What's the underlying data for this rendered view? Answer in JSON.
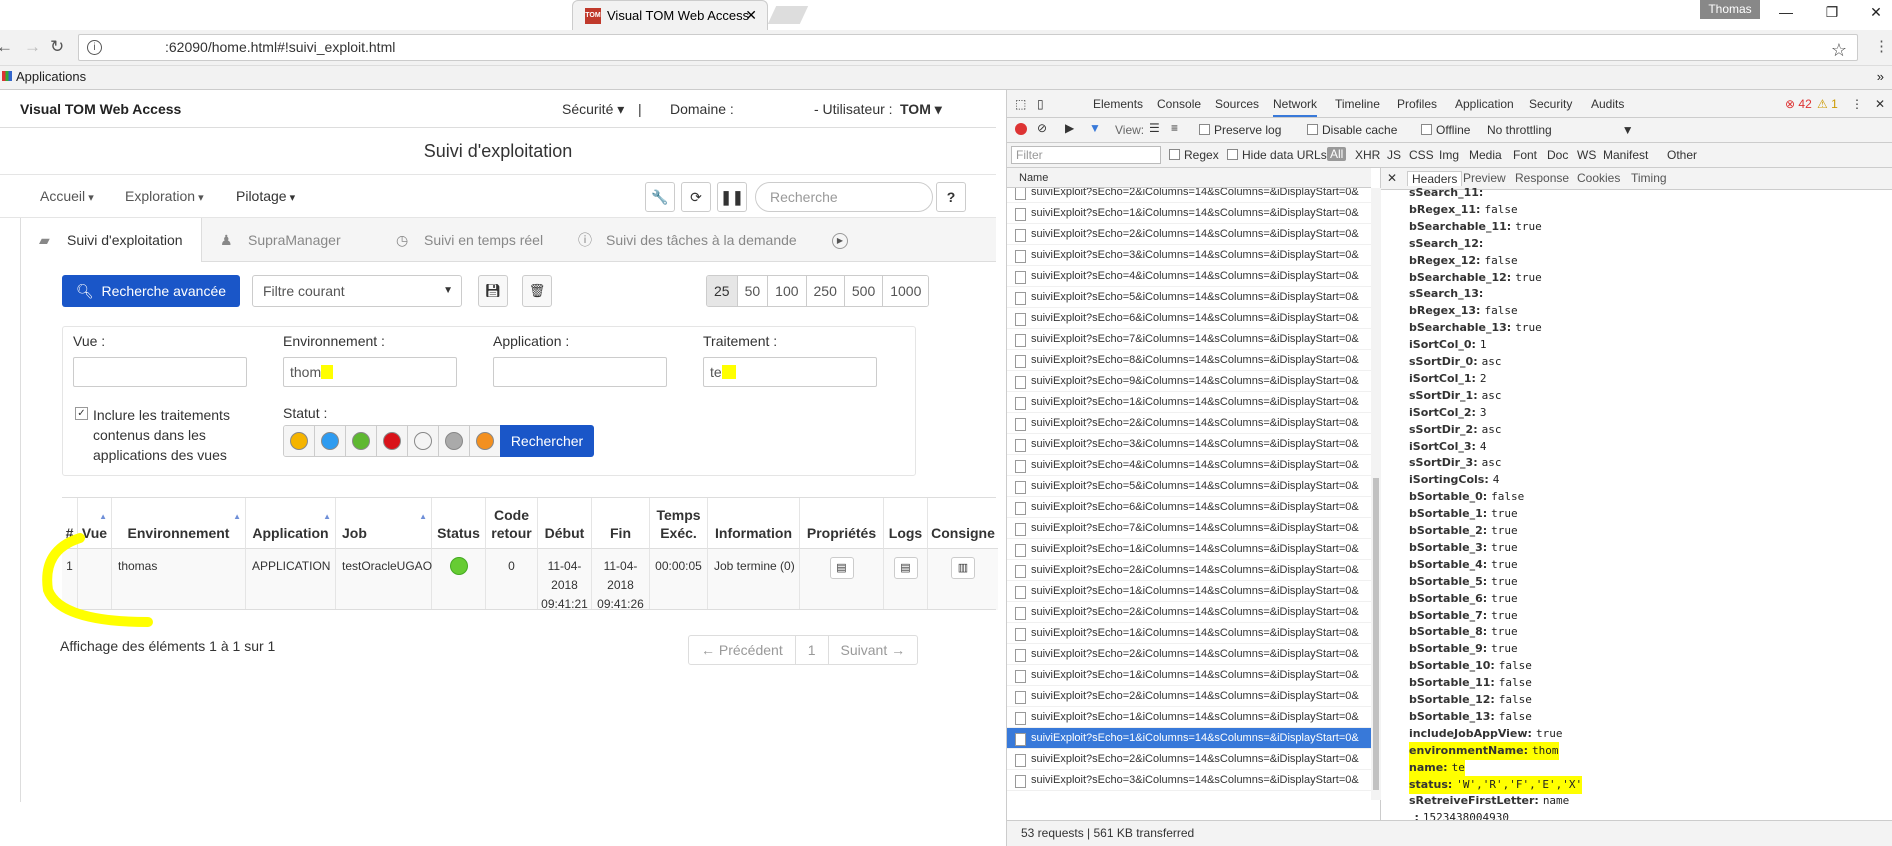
{
  "browser": {
    "tab_title": "Visual TOM Web Access",
    "tab_favicon": "TOM",
    "user": "Thomas",
    "url": ":62090/home.html#!suivi_exploit.html",
    "bookmarks_label": "Applications"
  },
  "app": {
    "brand": "Visual TOM Web Access",
    "nav": {
      "securite": "Sécurité",
      "sep": "|",
      "domaine_label": "Domaine :",
      "utilisateur_label": "- Utilisateur :",
      "utilisateur": "TOM"
    },
    "page_title": "Suivi d'exploitation",
    "menus": [
      "Accueil",
      "Exploration",
      "Pilotage"
    ],
    "search_placeholder": "Recherche",
    "help": "?",
    "tabs": [
      "Suivi d'exploitation",
      "SupraManager",
      "Suivi en temps réel",
      "Suivi des tâches à la demande"
    ],
    "adv_search": "Recherche avancée",
    "filter_select": "Filtre courant",
    "page_sizes": [
      "25",
      "50",
      "100",
      "250",
      "500",
      "1000"
    ],
    "filters": {
      "vue_label": "Vue :",
      "vue_value": "",
      "env_label": "Environnement :",
      "env_value": "thom",
      "app_label": "Application :",
      "app_value": "",
      "trait_label": "Traitement :",
      "trait_value": "te",
      "include_label": "Inclure les traitements contenus dans les applications des vues",
      "statut_label": "Statut :",
      "rechercher": "Rechercher"
    },
    "status_colors": [
      "#f5b400",
      "#2e9bf0",
      "#5fb832",
      "#d9131a",
      "#f4f4f4",
      "#aaaaaa",
      "#f39020"
    ],
    "grid": {
      "headers": [
        "#",
        "Vue",
        "Environnement",
        "Application",
        "Job",
        "Status",
        "Code retour",
        "Début",
        "Fin",
        "Temps Exéc.",
        "Information",
        "Propriétés",
        "Logs",
        "Consigne"
      ],
      "row": {
        "num": "1",
        "vue": "",
        "env": "thomas",
        "app": "APPLICATION",
        "job": "testOracleUGAO",
        "code": "0",
        "debut": "11-04-2018 09:41:21",
        "fin": "11-04-2018 09:41:26",
        "temps": "00:00:05",
        "info": "Job termine (0)"
      }
    },
    "info_text": "Affichage des éléments 1 à 1 sur 1",
    "pager": [
      "← Précédent",
      "1",
      "Suivant →"
    ]
  },
  "devtools": {
    "tabs": [
      "Elements",
      "Console",
      "Sources",
      "Network",
      "Timeline",
      "Profiles",
      "Application",
      "Security",
      "Audits"
    ],
    "errors": "42",
    "warnings": "1",
    "toolbar": {
      "view": "View:",
      "preserve": "Preserve log",
      "disable_cache": "Disable cache",
      "offline": "Offline",
      "throttle": "No throttling"
    },
    "filter_placeholder": "Filter",
    "filter_opts": [
      "Regex",
      "Hide data URLs"
    ],
    "types": [
      "All",
      "XHR",
      "JS",
      "CSS",
      "Img",
      "Media",
      "Font",
      "Doc",
      "WS",
      "Manifest",
      "Other"
    ],
    "name_header": "Name",
    "requests": [
      "suiviExploit?sEcho=2&iColumns=14&sColumns=&iDisplayStart=0&",
      "suiviExploit?sEcho=1&iColumns=14&sColumns=&iDisplayStart=0&",
      "suiviExploit?sEcho=2&iColumns=14&sColumns=&iDisplayStart=0&",
      "suiviExploit?sEcho=3&iColumns=14&sColumns=&iDisplayStart=0&",
      "suiviExploit?sEcho=4&iColumns=14&sColumns=&iDisplayStart=0&",
      "suiviExploit?sEcho=5&iColumns=14&sColumns=&iDisplayStart=0&",
      "suiviExploit?sEcho=6&iColumns=14&sColumns=&iDisplayStart=0&",
      "suiviExploit?sEcho=7&iColumns=14&sColumns=&iDisplayStart=0&",
      "suiviExploit?sEcho=8&iColumns=14&sColumns=&iDisplayStart=0&",
      "suiviExploit?sEcho=9&iColumns=14&sColumns=&iDisplayStart=0&",
      "suiviExploit?sEcho=1&iColumns=14&sColumns=&iDisplayStart=0&",
      "suiviExploit?sEcho=2&iColumns=14&sColumns=&iDisplayStart=0&",
      "suiviExploit?sEcho=3&iColumns=14&sColumns=&iDisplayStart=0&",
      "suiviExploit?sEcho=4&iColumns=14&sColumns=&iDisplayStart=0&",
      "suiviExploit?sEcho=5&iColumns=14&sColumns=&iDisplayStart=0&",
      "suiviExploit?sEcho=6&iColumns=14&sColumns=&iDisplayStart=0&",
      "suiviExploit?sEcho=7&iColumns=14&sColumns=&iDisplayStart=0&",
      "suiviExploit?sEcho=1&iColumns=14&sColumns=&iDisplayStart=0&",
      "suiviExploit?sEcho=2&iColumns=14&sColumns=&iDisplayStart=0&",
      "suiviExploit?sEcho=1&iColumns=14&sColumns=&iDisplayStart=0&",
      "suiviExploit?sEcho=2&iColumns=14&sColumns=&iDisplayStart=0&",
      "suiviExploit?sEcho=1&iColumns=14&sColumns=&iDisplayStart=0&",
      "suiviExploit?sEcho=2&iColumns=14&sColumns=&iDisplayStart=0&",
      "suiviExploit?sEcho=1&iColumns=14&sColumns=&iDisplayStart=0&",
      "suiviExploit?sEcho=2&iColumns=14&sColumns=&iDisplayStart=0&",
      "suiviExploit?sEcho=1&iColumns=14&sColumns=&iDisplayStart=0&",
      "suiviExploit?sEcho=1&iColumns=14&sColumns=&iDisplayStart=0&",
      "suiviExploit?sEcho=2&iColumns=14&sColumns=&iDisplayStart=0&",
      "suiviExploit?sEcho=3&iColumns=14&sColumns=&iDisplayStart=0&"
    ],
    "selected_index": 26,
    "status": "53 requests  |  561 KB transferred",
    "detail_tabs": [
      "Headers",
      "Preview",
      "Response",
      "Cookies",
      "Timing"
    ],
    "params": [
      [
        "sSearch_11:",
        ""
      ],
      [
        "bRegex_11:",
        "false"
      ],
      [
        "bSearchable_11:",
        "true"
      ],
      [
        "sSearch_12:",
        ""
      ],
      [
        "bRegex_12:",
        "false"
      ],
      [
        "bSearchable_12:",
        "true"
      ],
      [
        "sSearch_13:",
        ""
      ],
      [
        "bRegex_13:",
        "false"
      ],
      [
        "bSearchable_13:",
        "true"
      ],
      [
        "iSortCol_0:",
        "1"
      ],
      [
        "sSortDir_0:",
        "asc"
      ],
      [
        "iSortCol_1:",
        "2"
      ],
      [
        "sSortDir_1:",
        "asc"
      ],
      [
        "iSortCol_2:",
        "3"
      ],
      [
        "sSortDir_2:",
        "asc"
      ],
      [
        "iSortCol_3:",
        "4"
      ],
      [
        "sSortDir_3:",
        "asc"
      ],
      [
        "iSortingCols:",
        "4"
      ],
      [
        "bSortable_0:",
        "false"
      ],
      [
        "bSortable_1:",
        "true"
      ],
      [
        "bSortable_2:",
        "true"
      ],
      [
        "bSortable_3:",
        "true"
      ],
      [
        "bSortable_4:",
        "true"
      ],
      [
        "bSortable_5:",
        "true"
      ],
      [
        "bSortable_6:",
        "true"
      ],
      [
        "bSortable_7:",
        "true"
      ],
      [
        "bSortable_8:",
        "true"
      ],
      [
        "bSortable_9:",
        "true"
      ],
      [
        "bSortable_10:",
        "false"
      ],
      [
        "bSortable_11:",
        "false"
      ],
      [
        "bSortable_12:",
        "false"
      ],
      [
        "bSortable_13:",
        "false"
      ],
      [
        "includeJobAppView:",
        "true"
      ],
      [
        "environmentName:",
        "thom"
      ],
      [
        "name:",
        "te"
      ],
      [
        "status:",
        "'W','R','F','E','X'"
      ],
      [
        "sRetreiveFirstLetter:",
        "name"
      ],
      [
        "_:",
        "1523438004930"
      ]
    ],
    "highlighted": [
      33,
      34,
      35
    ]
  }
}
